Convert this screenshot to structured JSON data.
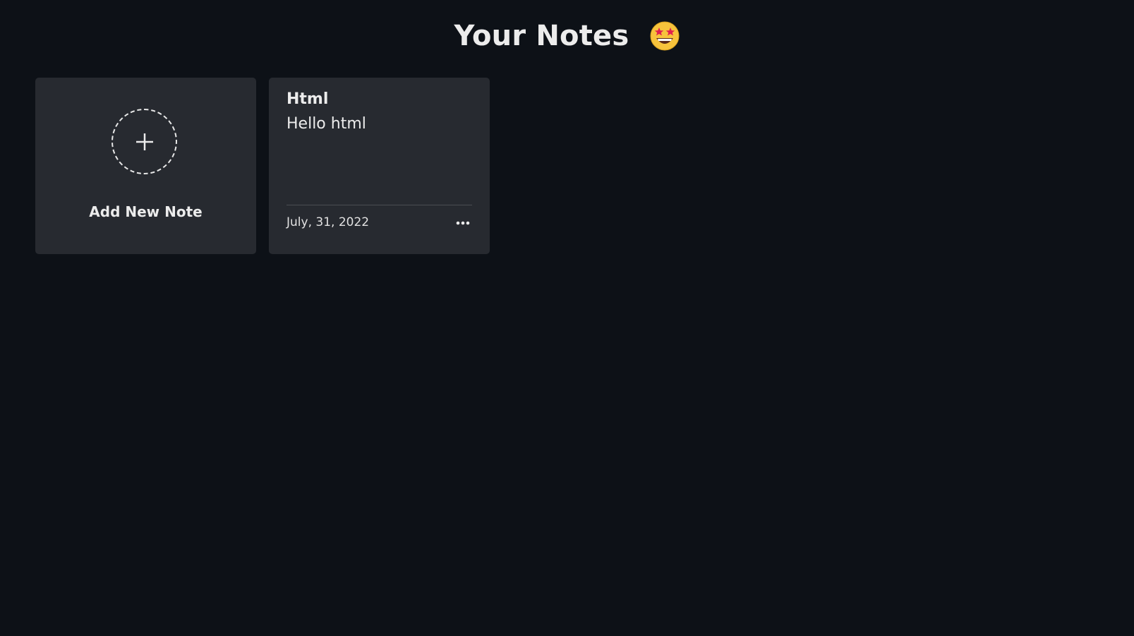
{
  "header": {
    "title": "Your Notes",
    "emoji_icon": "star-struck-emoji"
  },
  "add_card": {
    "label": "Add New Note",
    "icon": "plus-icon"
  },
  "notes": [
    {
      "title": "Html",
      "body": "Hello html",
      "date": "July, 31, 2022",
      "menu_icon": "more-horizontal-icon"
    }
  ],
  "colors": {
    "background": "#0d1117",
    "card": "#272a30",
    "text": "#ececec",
    "divider": "#4a4d52"
  }
}
